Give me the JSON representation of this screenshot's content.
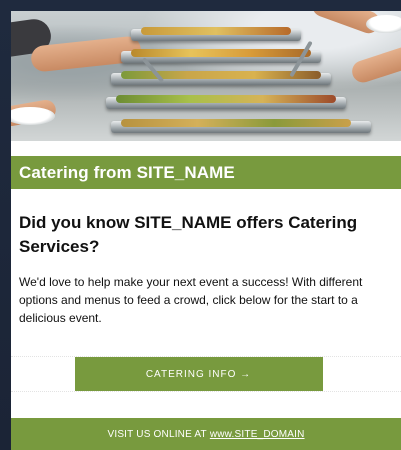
{
  "email": {
    "hero": {
      "alt_icon": "catering-buffet-image"
    },
    "title": "Catering from SITE_NAME",
    "heading": "Did you know SITE_NAME offers Catering Services?",
    "body": "We'd love to help make your next event a success! With different options and menus to feed a crowd, click below for the start to a delicious event.",
    "cta_label": "CATERING INFO →",
    "footer": {
      "prefix": "VISIT US ONLINE AT",
      "link_label": "www.SITE_DOMAIN"
    }
  },
  "colors": {
    "accent": "#789a3e",
    "background": "#1f2a3e",
    "card": "#ffffff",
    "text": "#111111"
  }
}
